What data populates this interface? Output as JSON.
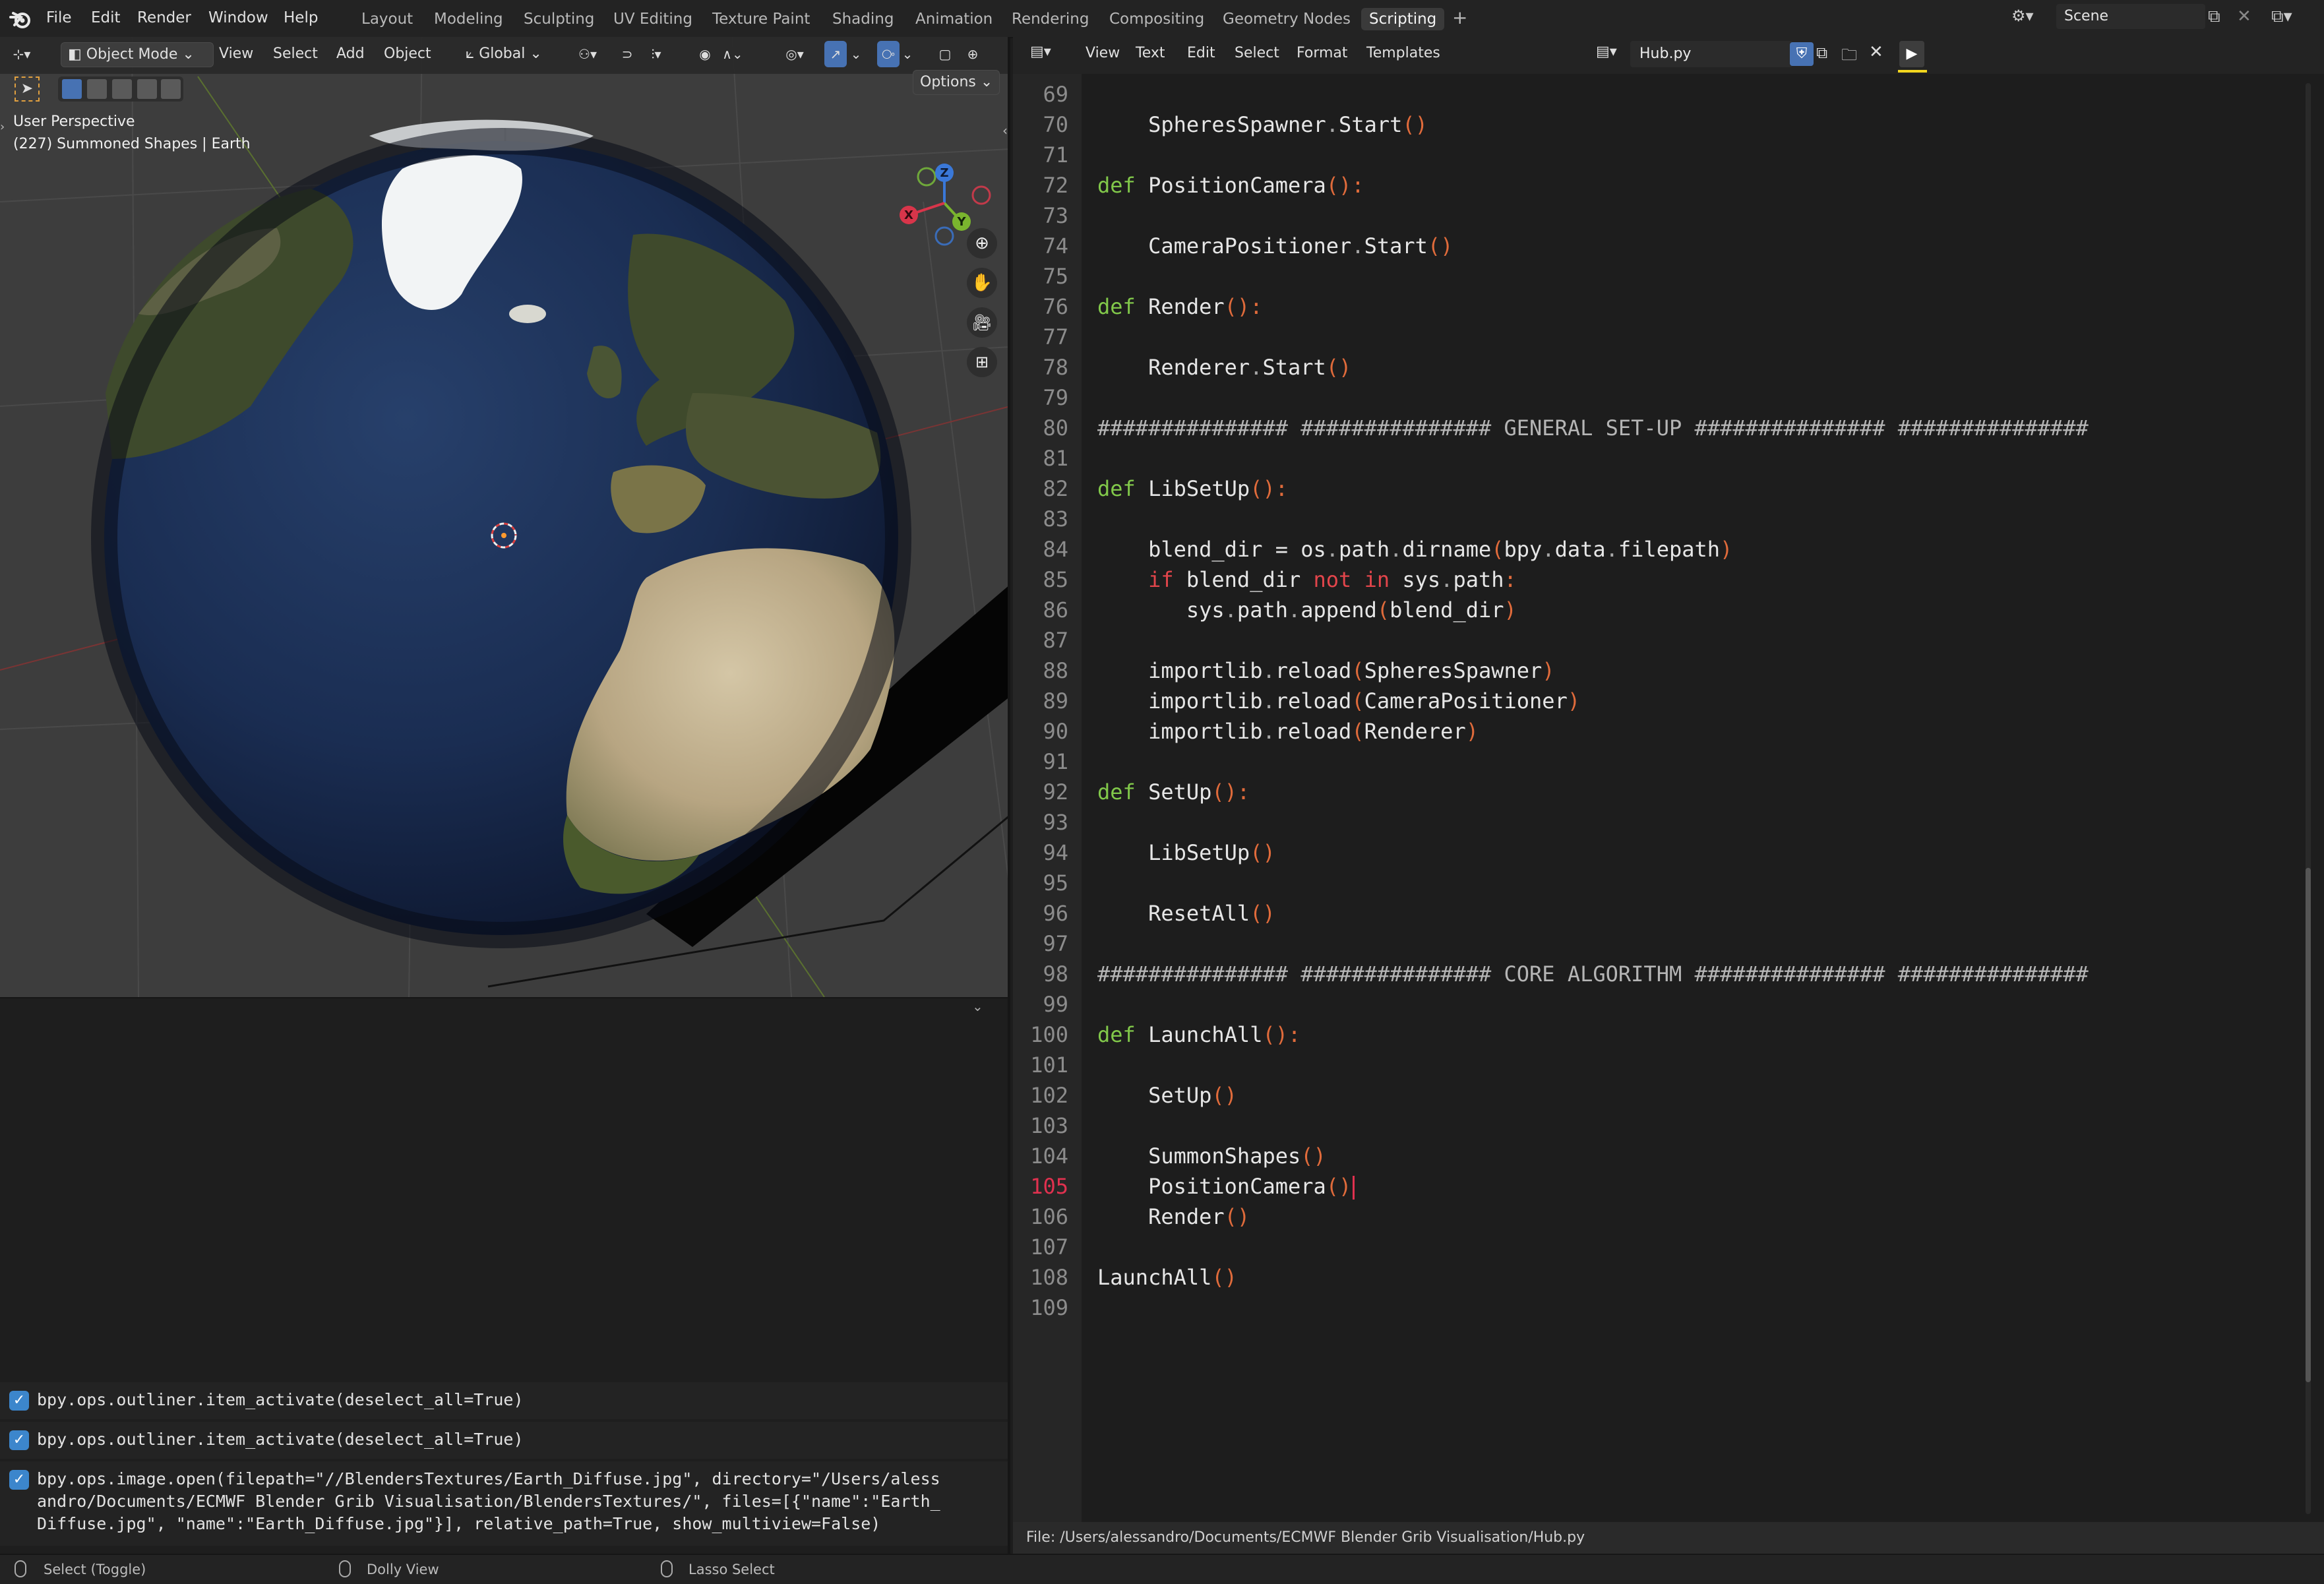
{
  "menubar": {
    "menus": [
      "File",
      "Edit",
      "Render",
      "Window",
      "Help"
    ],
    "workspaces": [
      "Layout",
      "Modeling",
      "Sculpting",
      "UV Editing",
      "Texture Paint",
      "Shading",
      "Animation",
      "Rendering",
      "Compositing",
      "Geometry Nodes",
      "Scripting"
    ],
    "active_workspace": "Scripting",
    "scene_name": "Scene"
  },
  "viewport": {
    "mode": "Object Mode",
    "menus": [
      "View",
      "Select",
      "Add",
      "Object"
    ],
    "transform_orientation": "Global",
    "options_label": "Options",
    "perspective_label": "User Perspective",
    "object_info": "(227) Summoned Shapes | Earth",
    "gizmo_axes": {
      "x": "X",
      "y": "Y",
      "z": "Z"
    }
  },
  "info_log": [
    "bpy.ops.outliner.item_activate(deselect_all=True)",
    "bpy.ops.outliner.item_activate(deselect_all=True)",
    "bpy.ops.image.open(filepath=\"//BlendersTextures/Earth_Diffuse.jpg\", directory=\"/Users/alessandro/Documents/ECMWF Blender Grib Visualisation/BlendersTextures/\", files=[{\"name\":\"Earth_Diffuse.jpg\", \"name\":\"Earth_Diffuse.jpg\"}], relative_path=True, show_multiview=False)"
  ],
  "info_log_display": [
    [
      "bpy.ops.outliner.item_activate(deselect_all=True)"
    ],
    [
      "bpy.ops.outliner.item_activate(deselect_all=True)"
    ],
    [
      "bpy.ops.image.open(filepath=\"//BlendersTextures/Earth_Diffuse.jpg\", directory=\"/Users/aless",
      "andro/Documents/ECMWF Blender Grib Visualisation/BlendersTextures/\", files=[{\"name\":\"Earth_",
      "Diffuse.jpg\", \"name\":\"Earth_Diffuse.jpg\"}], relative_path=True, show_multiview=False)"
    ]
  ],
  "editor": {
    "menus": [
      "View",
      "Text",
      "Edit",
      "Select",
      "Format",
      "Templates"
    ],
    "filename": "Hub.py",
    "current_line": 105,
    "file_path": "File: /Users/alessandro/Documents/ECMWF Blender Grib Visualisation/Hub.py",
    "line_numbers": [
      "69",
      "70",
      "71",
      "72",
      "73",
      "74",
      "75",
      "76",
      "77",
      "78",
      "79",
      "80",
      "81",
      "82",
      "83",
      "84",
      "85",
      "86",
      "87",
      "88",
      "89",
      "90",
      "91",
      "92",
      "93",
      "94",
      "95",
      "96",
      "97",
      "98",
      "99",
      "100",
      "101",
      "102",
      "103",
      "104",
      "105",
      "106",
      "107",
      "108",
      "109"
    ],
    "code_lines": [
      "",
      "    SpheresSpawner.Start()",
      "",
      "def PositionCamera():",
      "",
      "    CameraPositioner.Start()",
      "",
      "def Render():",
      "",
      "    Renderer.Start()",
      "",
      "############### ############### GENERAL SET-UP ############### ###############",
      "",
      "def LibSetUp():",
      "",
      "    blend_dir = os.path.dirname(bpy.data.filepath)",
      "    if blend_dir not in sys.path:",
      "       sys.path.append(blend_dir)",
      "",
      "    importlib.reload(SpheresSpawner)",
      "    importlib.reload(CameraPositioner)",
      "    importlib.reload(Renderer)",
      "",
      "def SetUp():",
      "",
      "    LibSetUp()",
      "",
      "    ResetAll()",
      "",
      "############### ############### CORE ALGORITHM ############### ###############",
      "",
      "def LaunchAll():",
      "",
      "    SetUp()",
      "",
      "    SummonShapes()",
      "    PositionCamera()",
      "    Render()",
      "",
      "LaunchAll()",
      ""
    ]
  },
  "statusbar": {
    "items": [
      "Select (Toggle)",
      "Dolly View",
      "Lasso Select"
    ]
  },
  "colors": {
    "keyword_def": "#81c84a",
    "keyword_flow": "#e2454b",
    "paren": "#e06b3b",
    "active_line_number": "#e0314f",
    "checkbox": "#3c86cc"
  }
}
